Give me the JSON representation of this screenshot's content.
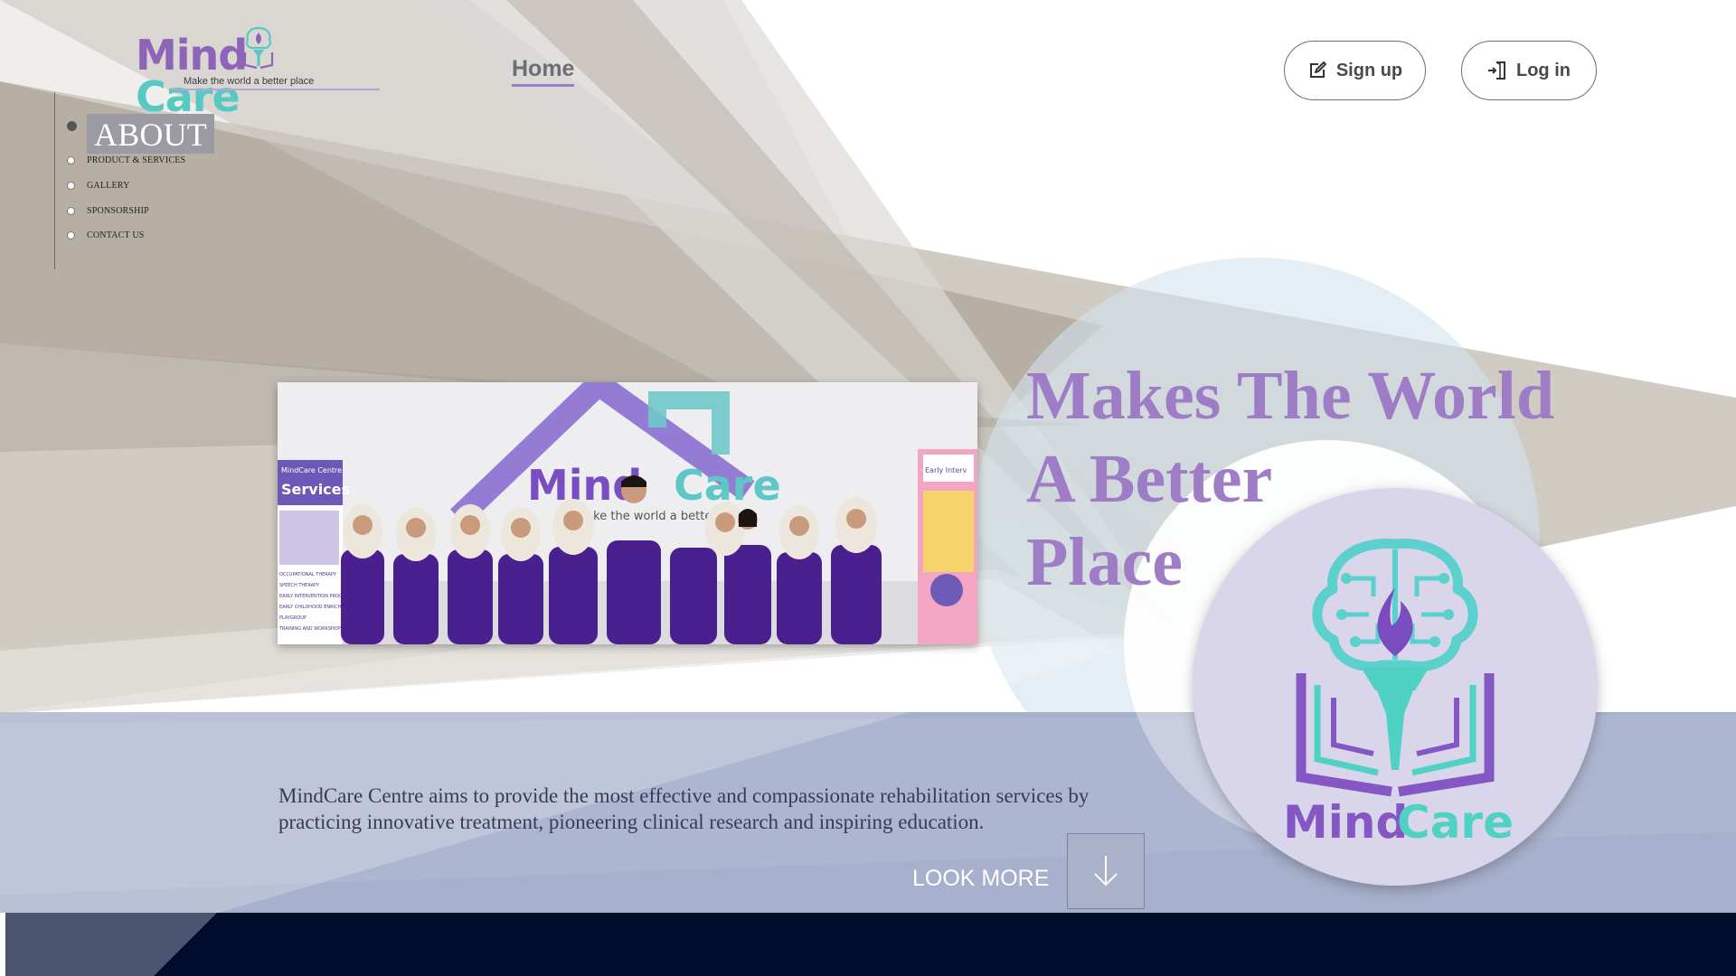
{
  "header": {
    "logo": {
      "word_left": "Mind",
      "word_right": "Care",
      "tagline": "Make the world a better place"
    },
    "nav_home": "Home",
    "signup_label": "Sign up",
    "login_label": "Log in"
  },
  "side_nav": {
    "items": [
      {
        "label": "ABOUT",
        "active": true
      },
      {
        "label": "PRODUCT & SERVICES",
        "active": false
      },
      {
        "label": "GALLERY",
        "active": false
      },
      {
        "label": "SPONSORSHIP",
        "active": false
      },
      {
        "label": "CONTACT US",
        "active": false
      }
    ]
  },
  "hero": {
    "title_lines": [
      "Makes The World",
      "A Better",
      "Place"
    ],
    "photo": {
      "banner_left_title": "Services",
      "banner_left_small": "MindCare Centre",
      "banner_left_items": [
        "OCCUPATIONAL THERAPY",
        "SPEECH THERAPY",
        "EARLY INTERVENTION PROGRAM",
        "EARLY CHILDHOOD ENRICHMENT PROGRAM",
        "PLAYGROUP",
        "TRAINING AND WORKSHOP"
      ],
      "wall_word_left": "Mind",
      "wall_word_right": "Care",
      "wall_tagline": "Make the world a better place",
      "banner_right_title": "Early Interv"
    },
    "description": "MindCare Centre aims to provide the most effective and compassionate rehabilitation services by practicing innovative treatment, pioneering clinical research and inspiring education.",
    "look_more_label": "LOOK MORE"
  },
  "big_logo": {
    "word_left": "Mind",
    "word_right": "Care"
  },
  "colors": {
    "brand_purple": "#8e64b8",
    "brand_teal": "#56c9c2",
    "title_purple": "#9e7cc6",
    "footer_navy": "#000c2c",
    "band_blue": "#a7b0cc",
    "bg_taupe": "#b6aea3"
  },
  "icons": {
    "signup": "edit-icon",
    "login": "login-icon",
    "look_more": "arrow-down-icon",
    "logo": "brain-torch-book-icon"
  }
}
